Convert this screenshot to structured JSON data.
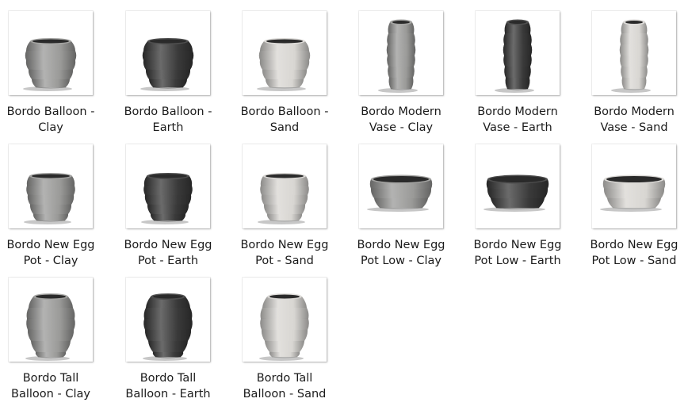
{
  "colors": {
    "Clay": "#9a9a98",
    "Earth": "#3a3a3a",
    "Sand": "#d8d6d2"
  },
  "files": [
    {
      "label": "Bordo Balloon -\nClay",
      "shape": "balloon",
      "finish": "Clay",
      "icon": "balloon-pot-thumbnail"
    },
    {
      "label": "Bordo Balloon -\nEarth",
      "shape": "balloon",
      "finish": "Earth",
      "icon": "balloon-pot-thumbnail"
    },
    {
      "label": "Bordo Balloon -\nSand",
      "shape": "balloon",
      "finish": "Sand",
      "icon": "balloon-pot-thumbnail"
    },
    {
      "label": "Bordo Modern\nVase - Clay",
      "shape": "vase",
      "finish": "Clay",
      "icon": "vase-thumbnail"
    },
    {
      "label": "Bordo Modern\nVase - Earth",
      "shape": "vase",
      "finish": "Earth",
      "icon": "vase-thumbnail"
    },
    {
      "label": "Bordo Modern\nVase - Sand",
      "shape": "vase",
      "finish": "Sand",
      "icon": "vase-thumbnail"
    },
    {
      "label": "Bordo New Egg\nPot - Clay",
      "shape": "egg",
      "finish": "Clay",
      "icon": "egg-pot-thumbnail"
    },
    {
      "label": "Bordo New Egg\nPot - Earth",
      "shape": "egg",
      "finish": "Earth",
      "icon": "egg-pot-thumbnail"
    },
    {
      "label": "Bordo New Egg\nPot - Sand",
      "shape": "egg",
      "finish": "Sand",
      "icon": "egg-pot-thumbnail"
    },
    {
      "label": "Bordo New Egg\nPot Low - Clay",
      "shape": "low",
      "finish": "Clay",
      "icon": "low-bowl-pot-thumbnail"
    },
    {
      "label": "Bordo New Egg\nPot Low - Earth",
      "shape": "low",
      "finish": "Earth",
      "icon": "low-bowl-pot-thumbnail"
    },
    {
      "label": "Bordo New Egg\nPot Low - Sand",
      "shape": "low",
      "finish": "Sand",
      "icon": "low-bowl-pot-thumbnail"
    },
    {
      "label": "Bordo Tall\nBalloon - Clay",
      "shape": "tall",
      "finish": "Clay",
      "icon": "tall-balloon-pot-thumbnail"
    },
    {
      "label": "Bordo Tall\nBalloon - Earth",
      "shape": "tall",
      "finish": "Earth",
      "icon": "tall-balloon-pot-thumbnail"
    },
    {
      "label": "Bordo Tall\nBalloon - Sand",
      "shape": "tall",
      "finish": "Sand",
      "icon": "tall-balloon-pot-thumbnail"
    }
  ]
}
